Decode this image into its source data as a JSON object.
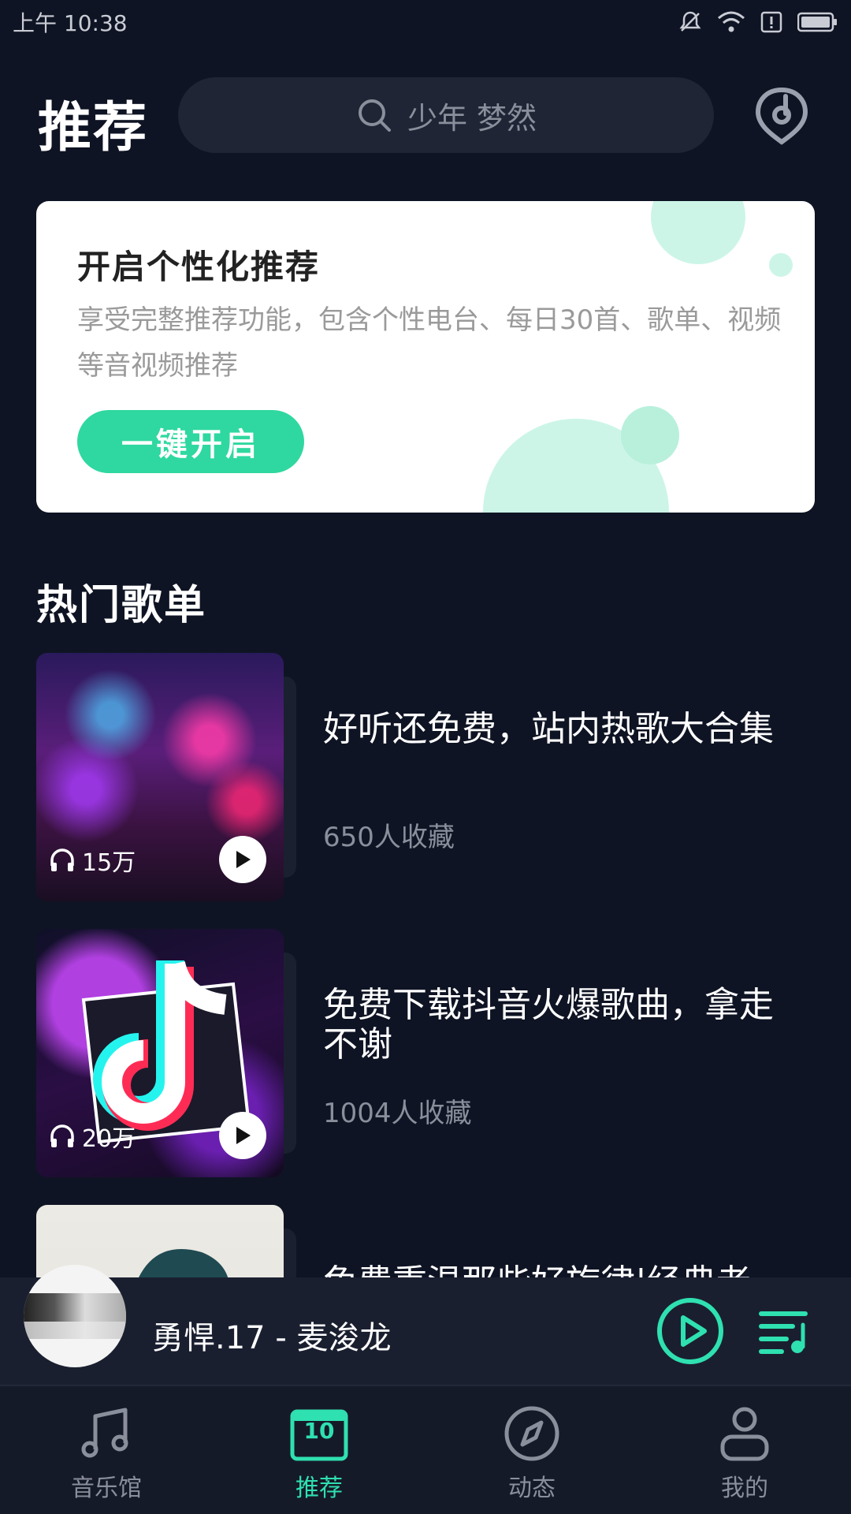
{
  "status_bar": {
    "time": "上午 10:38"
  },
  "header": {
    "title": "推荐",
    "search_placeholder": "少年 梦然"
  },
  "promo": {
    "title": "开启个性化推荐",
    "description": "享受完整推荐功能，包含个性电台、每日30首、歌单、视频等音视频推荐",
    "button_label": "一键开启"
  },
  "section": {
    "title": "热门歌单"
  },
  "playlists": [
    {
      "title": "好听还免费，站内热歌大合集",
      "subtitle": "650人收藏",
      "play_count": "15万"
    },
    {
      "title": "免费下载抖音火爆歌曲，拿走不谢",
      "subtitle": "1004人收藏",
      "play_count": "20万"
    },
    {
      "title": "免费重温那些好旋律|经典老",
      "subtitle": "",
      "play_count": ""
    }
  ],
  "mini_player": {
    "now_playing": "勇悍.17 - 麦浚龙"
  },
  "tabs": [
    {
      "label": "音乐馆",
      "icon": "music-note-icon"
    },
    {
      "label": "推荐",
      "icon": "calendar-icon",
      "badge": "10"
    },
    {
      "label": "动态",
      "icon": "compass-icon"
    },
    {
      "label": "我的",
      "icon": "person-icon"
    }
  ],
  "colors": {
    "accent": "#2fe0b0",
    "background": "#0f1424",
    "button": "#2fd8a0"
  }
}
